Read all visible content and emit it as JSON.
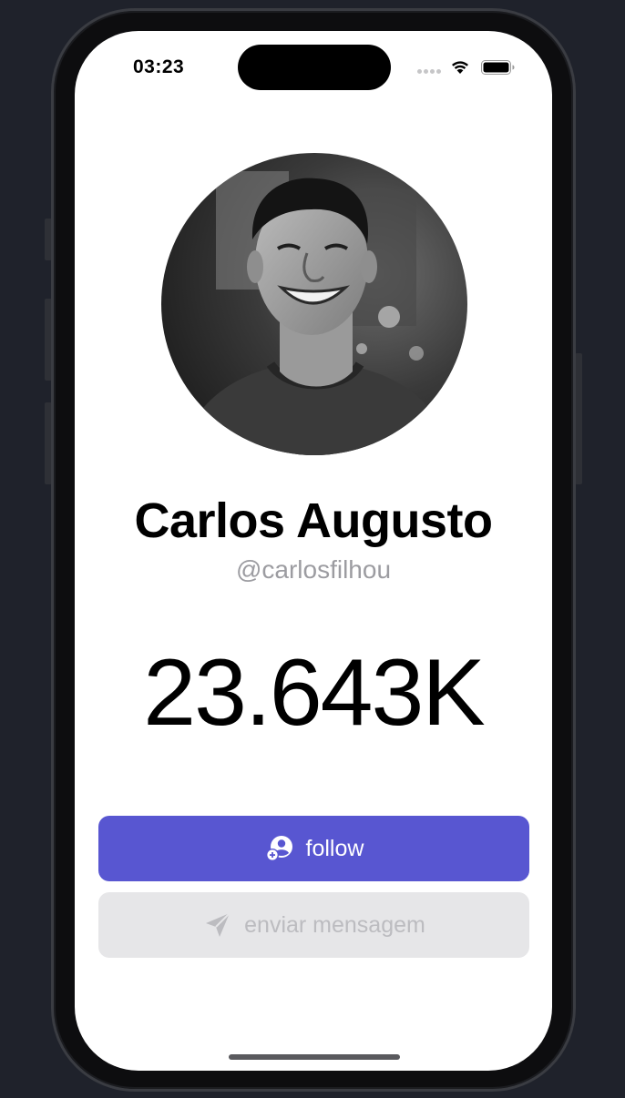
{
  "status_bar": {
    "time": "03:23",
    "wifi_icon": "wifi-icon",
    "battery_icon": "battery-full-icon",
    "signal_icon": "cellular-signal-icon"
  },
  "profile": {
    "name": "Carlos Augusto",
    "handle": "@carlosfilhou",
    "count": "23.643K",
    "avatar": "profile-photo"
  },
  "actions": {
    "follow_label": "follow",
    "follow_icon": "person-add-icon",
    "message_label": "enviar mensagem",
    "message_icon": "paper-plane-icon"
  },
  "colors": {
    "accent": "#5856d1",
    "secondary_button_bg": "#e6e6e8",
    "secondary_button_text": "#bcbcc0",
    "handle_text": "#9c9ca1",
    "background": "#1f222b"
  }
}
